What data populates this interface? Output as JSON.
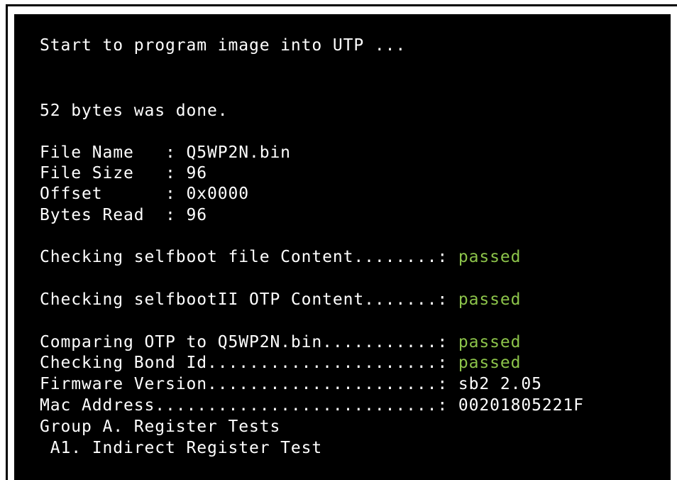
{
  "terminal": {
    "start_msg": "Start to program image into UTP ...",
    "done_msg": "52 bytes was done.",
    "file_name": "File Name   : Q5WP2N.bin",
    "file_size": "File Size   : 96",
    "offset": "Offset      : 0x0000",
    "bytes_read": "Bytes Read  : 96",
    "check_selfboot_label": "Checking selfboot file Content........: ",
    "check_selfboot_status": "passed",
    "check_selfbootII_label": "Checking selfbootII OTP Content.......: ",
    "check_selfbootII_status": "passed",
    "compare_otp_label": "Comparing OTP to Q5WP2N.bin...........: ",
    "compare_otp_status": "passed",
    "bond_id_label": "Checking Bond Id......................: ",
    "bond_id_status": "passed",
    "firmware_label": "Firmware Version......................: ",
    "firmware_value": "sb2 2.05",
    "mac_label": "Mac Address...........................: ",
    "mac_value": "00201805221F",
    "group_a": "Group A. Register Tests",
    "a1": " A1. Indirect Register Test"
  },
  "colors": {
    "background": "#000000",
    "text": "#ffffff",
    "passed": "#8cc34a"
  }
}
